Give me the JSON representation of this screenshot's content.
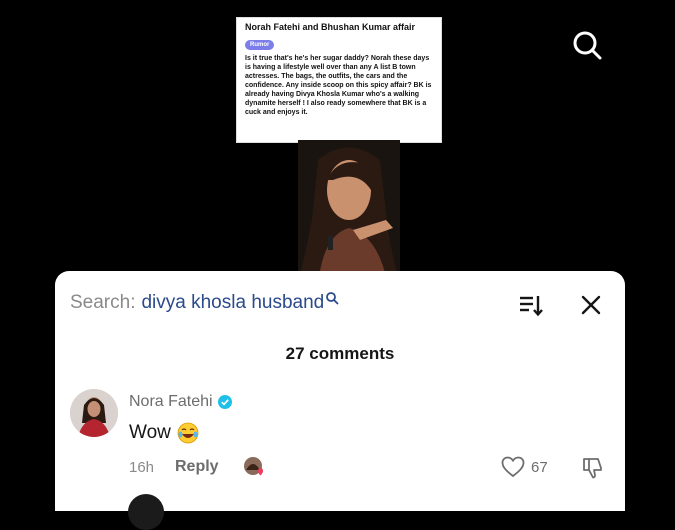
{
  "rumor_card": {
    "title": "Norah Fatehi and Bhushan Kumar affair",
    "tag": "Rumor",
    "body": "Is it true that's he's her sugar daddy? Norah these days is having a lifestyle well over than any A list B town actresses. The bags, the outfits, the cars and the confidence. Any inside scoop on this spicy affair? BK is already having Divya Khosla Kumar who's a walking dynamite herself ! I also ready somewhere that BK is a cuck and enjoys it."
  },
  "icons": {
    "top_search": "search-icon",
    "search_inline": "search-icon",
    "sort": "sort-icon",
    "close": "close-icon",
    "verified": "verified-badge-icon",
    "emoji": "laughing-tears-emoji",
    "like": "heart-outline-icon",
    "dislike": "thumbs-down-icon"
  },
  "search": {
    "prefix": "Search:",
    "query": "divya khosla husband"
  },
  "comments": {
    "count_label": "27 comments",
    "items": [
      {
        "username": "Nora Fatehi",
        "text": "Wow",
        "time": "16h",
        "reply_label": "Reply",
        "like_count": "67"
      }
    ]
  },
  "colors": {
    "background": "#000000",
    "sheet": "#ffffff",
    "search_query": "#2b4a8c",
    "verified": "#20c0e8",
    "rumor_tag": "#7b7ee8"
  }
}
